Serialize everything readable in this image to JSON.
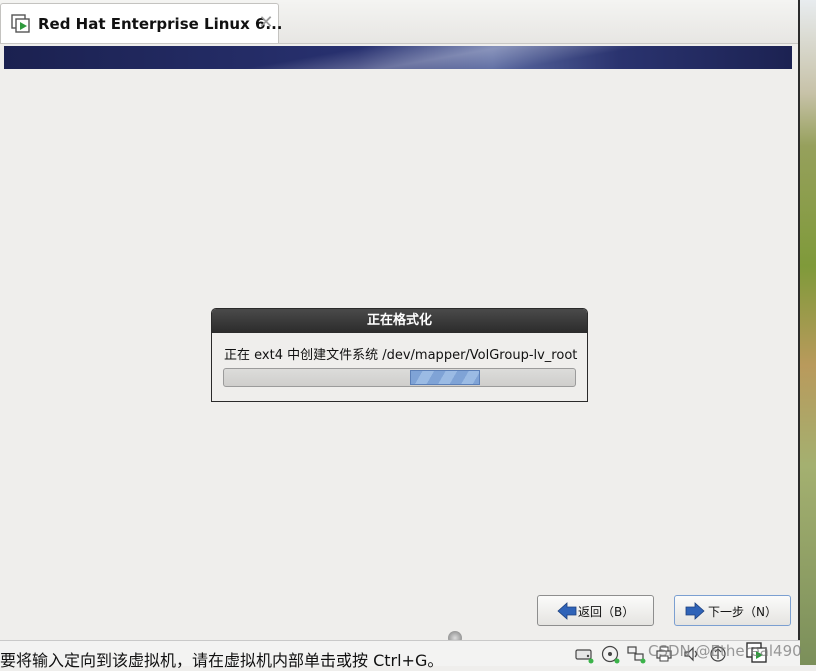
{
  "tab": {
    "title": "Red Hat Enterprise Linux 6...",
    "close": "✕"
  },
  "dialog": {
    "title": "正在格式化",
    "message": "正在 ext4 中创建文件系统 /dev/mapper/VolGroup-lv_root",
    "progress_fill_start": 0.53,
    "progress_fill_width": 0.2
  },
  "buttons": {
    "back": "返回（B）",
    "next": "下一步（N）"
  },
  "status": {
    "text": "要将输入定向到该虚拟机，请在虚拟机内部单击或按 Ctrl+G。"
  },
  "watermark": "CSDN @Ethereal490",
  "colors": {
    "banner": "#1b2150",
    "dialog_header": "#2b2b2b",
    "progress_fill": "#7fa3d6",
    "nav_arrow": "#2f63b8"
  },
  "icons": {
    "tab": "vm-tab-icon",
    "back": "back-arrow-icon",
    "next": "next-arrow-icon",
    "tray": [
      "hard-disk-icon",
      "cd-dvd-icon",
      "network-icon",
      "printer-icon",
      "sound-icon",
      "usb-icon"
    ]
  }
}
